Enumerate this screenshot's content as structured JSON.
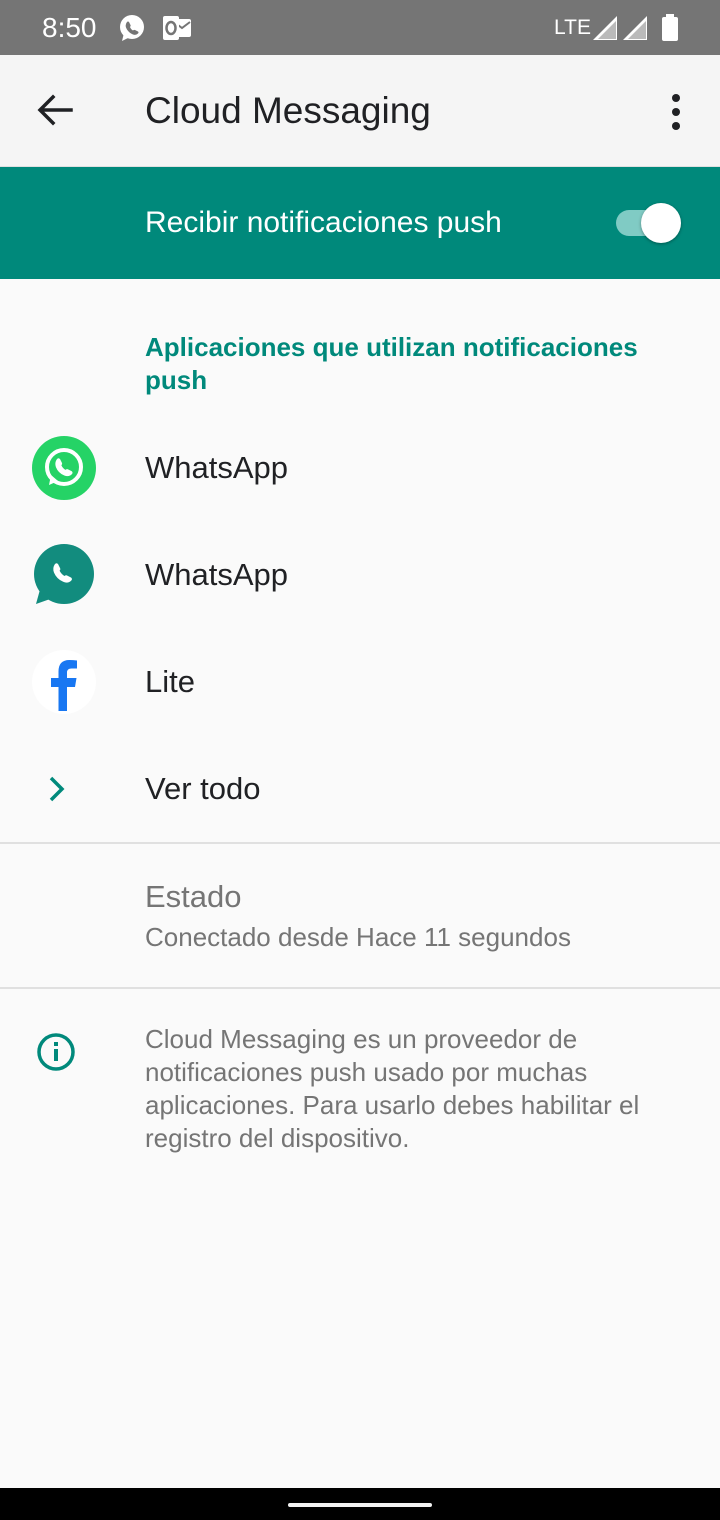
{
  "status_bar": {
    "time": "8:50",
    "network": "LTE",
    "notification_icons": [
      "whatsapp-icon",
      "outlook-icon"
    ],
    "right_icons": [
      "signal-icon",
      "signal-icon",
      "battery-icon"
    ]
  },
  "app_bar": {
    "title": "Cloud Messaging",
    "back_icon": "arrow-left-icon",
    "menu_icon": "more-vert-icon"
  },
  "push_toggle": {
    "label": "Recibir notificaciones push",
    "enabled": true
  },
  "apps_section": {
    "header": "Aplicaciones que utilizan notificaciones push",
    "apps": [
      {
        "label": "WhatsApp",
        "icon": "whatsapp-icon"
      },
      {
        "label": "WhatsApp",
        "icon": "whatsapp-business-icon"
      },
      {
        "label": "Lite",
        "icon": "facebook-lite-icon"
      }
    ],
    "see_all": "Ver todo"
  },
  "status_section": {
    "title": "Estado",
    "value": "Conectado desde Hace 11 segundos"
  },
  "info": {
    "text": "Cloud Messaging es un proveedor de notificaciones push usado por muchas aplicaciones. Para usarlo debes habilitar el registro del dispositivo."
  },
  "colors": {
    "accent": "#00897b",
    "status_bar": "#757575",
    "whatsapp_green": "#25d366",
    "whatsapp_business": "#128c7e",
    "facebook_blue": "#1877f2"
  }
}
